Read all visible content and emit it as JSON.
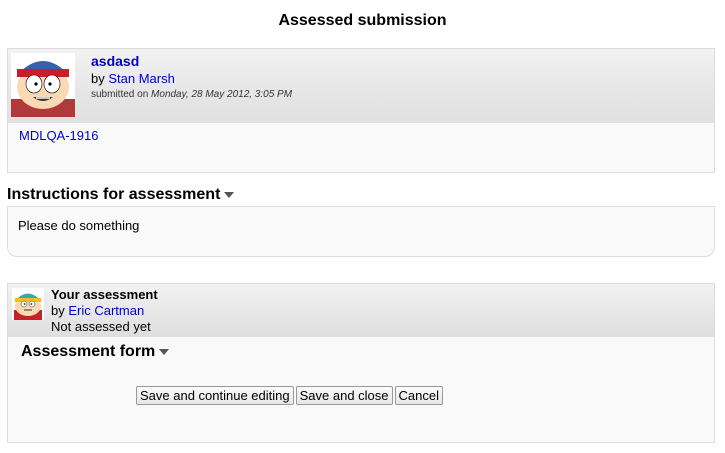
{
  "page": {
    "title": "Assessed submission"
  },
  "submission": {
    "title": "asdasd",
    "by_prefix": "by",
    "author": "Stan Marsh",
    "submitted_prefix": "submitted on",
    "date": "Monday, 28 May 2012, 3:05 PM",
    "content_link": "MDLQA-1916"
  },
  "instructions": {
    "heading": "Instructions for assessment",
    "text": "Please do something"
  },
  "assessment": {
    "title": "Your assessment",
    "by_prefix": "by",
    "assessor": "Eric Cartman",
    "status": "Not assessed yet",
    "form_heading": "Assessment form",
    "buttons": {
      "save_continue": "Save and continue editing",
      "save_close": "Save and close",
      "cancel": "Cancel"
    }
  },
  "colors": {
    "link": "#0000cc",
    "panel_bg": "#f9f9f9",
    "border": "#dddddd"
  },
  "icons": [
    "avatar-stan-marsh",
    "avatar-eric-cartman",
    "chevron-down-icon"
  ]
}
